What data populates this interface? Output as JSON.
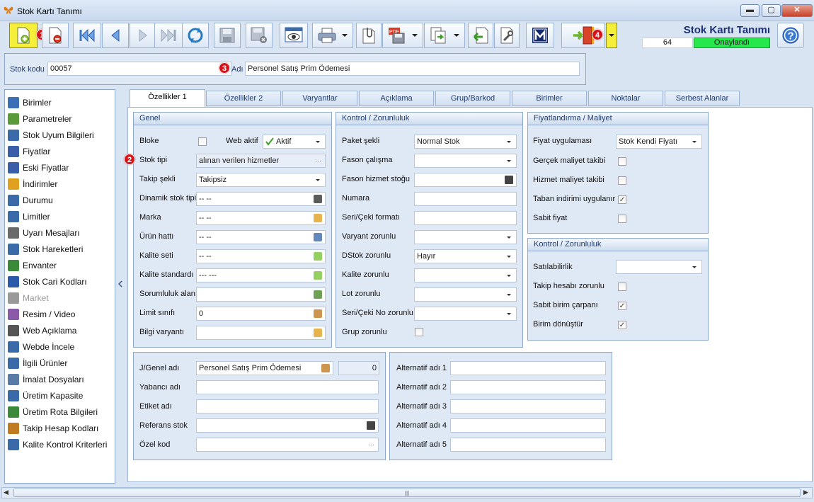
{
  "window": {
    "title": "Stok Kartı Tanımı",
    "controls": {
      "minimize": "▬",
      "maximize": "▢",
      "close": "✕"
    }
  },
  "toolbar": {
    "badges": [
      "1",
      "4"
    ],
    "header_title": "Stok Kartı Tanımı",
    "record_count": "64",
    "status": "Onaylandı",
    "status_color": "#26e84c",
    "icons": [
      "new-document-icon",
      "delete-document-icon",
      "first-record-icon",
      "previous-record-icon",
      "next-record-icon",
      "last-record-icon",
      "refresh-icon",
      "save-icon",
      "save-delete-icon",
      "preview-icon",
      "print-icon",
      "attachment-icon",
      "pdf-export-icon",
      "copy-export-icon",
      "import-icon",
      "tools-icon",
      "m-logo-icon",
      "exit-door-icon",
      "help-icon"
    ]
  },
  "stock": {
    "code_label": "Stok kodu",
    "code_value": "00057",
    "name_label": "Adı",
    "name_value": "Personel Satış Prim Ödemesi",
    "badge3": "3"
  },
  "nav": {
    "items": [
      {
        "label": "Birimler",
        "color": "#3b6fb6"
      },
      {
        "label": "Parametreler",
        "color": "#5a9a3a"
      },
      {
        "label": "Stok Uyum Bilgileri",
        "color": "#3a6aa8"
      },
      {
        "label": "Fiyatlar",
        "color": "#3a5ea8"
      },
      {
        "label": "Eski Fiyatlar",
        "color": "#3a5ea8"
      },
      {
        "label": "İndirimler",
        "color": "#e0a020"
      },
      {
        "label": "Durumu",
        "color": "#3a6aa8"
      },
      {
        "label": "Limitler",
        "color": "#3a6aa8"
      },
      {
        "label": "Uyarı Mesajları",
        "color": "#6a6a6a"
      },
      {
        "label": "Stok Hareketleri",
        "color": "#3a6aa8"
      },
      {
        "label": "Envanter",
        "color": "#3a8a3a"
      },
      {
        "label": "Stok Cari Kodları",
        "color": "#2a5aa8"
      },
      {
        "label": "Market",
        "color": "#999999"
      },
      {
        "label": "Resim / Video",
        "color": "#8a5aa8"
      },
      {
        "label": "Web Açıklama",
        "color": "#555555"
      },
      {
        "label": "Webde İncele",
        "color": "#3a6aa8"
      },
      {
        "label": "İlgili Ürünler",
        "color": "#3a6aa8"
      },
      {
        "label": "İmalat Dosyaları",
        "color": "#5a7aa8"
      },
      {
        "label": "Üretim Kapasite",
        "color": "#3a6aa8"
      },
      {
        "label": "Üretim Rota Bilgileri",
        "color": "#3a8a3a"
      },
      {
        "label": "Takip Hesap Kodları",
        "color": "#c07a20"
      },
      {
        "label": "Kalite Kontrol Kriterleri",
        "color": "#3a6aa8"
      }
    ]
  },
  "tabs": [
    "Özellikler 1",
    "Özellikler 2",
    "Varyantlar",
    "Açıklama",
    "Grup/Barkod",
    "Birimler",
    "Noktalar",
    "Serbest Alanlar"
  ],
  "genel": {
    "title": "Genel",
    "bloke": "Bloke",
    "web_aktif": "Web aktif",
    "web_aktif_value": "Aktif",
    "badge2": "2",
    "rows": [
      {
        "label": "Stok tipi",
        "value": "alınan verilen hizmetler"
      },
      {
        "label": "Takip şekli",
        "value": "Takipsiz"
      },
      {
        "label": "Dinamik stok tipi",
        "value": "-- --"
      },
      {
        "label": "Marka",
        "value": "-- --"
      },
      {
        "label": "Ürün hattı",
        "value": "-- --"
      },
      {
        "label": "Kalite seti",
        "value": "-- --"
      },
      {
        "label": "Kalite standardı",
        "value": "--- ---"
      },
      {
        "label": "Sorumluluk alanı",
        "value": ""
      },
      {
        "label": "Limit sınıfı",
        "value": "0"
      },
      {
        "label": "Bilgi varyantı",
        "value": ""
      }
    ]
  },
  "kontrol": {
    "title": "Kontrol / Zorunluluk",
    "rows": [
      {
        "label": "Paket şekli",
        "value": "Normal Stok"
      },
      {
        "label": "Fason çalışma",
        "value": ""
      },
      {
        "label": "Fason hizmet stoğu",
        "value": ""
      },
      {
        "label": "Numara",
        "value": ""
      },
      {
        "label": "Seri/Çeki formatı",
        "value": ""
      },
      {
        "label": "Varyant zorunlu",
        "value": ""
      },
      {
        "label": "DStok zorunlu",
        "value": "Hayır"
      },
      {
        "label": "Kalite zorunlu",
        "value": ""
      },
      {
        "label": "Lot zorunlu",
        "value": ""
      },
      {
        "label": "Seri/Çeki No zorunlu",
        "value": ""
      },
      {
        "label": "Grup zorunlu",
        "value": ""
      }
    ]
  },
  "fiyat": {
    "title": "Fiyatlandırma / Maliyet",
    "uygulama_label": "Fiyat uygulaması",
    "uygulama_value": "Stok Kendi Fiyatı",
    "checks": [
      {
        "label": "Gerçek maliyet takibi",
        "checked": false
      },
      {
        "label": "Hizmet maliyet takibi",
        "checked": false
      },
      {
        "label": "Taban indirimi uygulanır",
        "checked": true
      },
      {
        "label": "Sabit fiyat",
        "checked": false
      }
    ]
  },
  "kontrol2": {
    "title": "Kontrol / Zorunluluk",
    "satilabilirlik": "Satılabilirlik",
    "checks": [
      {
        "label": "Takip hesabı zorunlu",
        "checked": false
      },
      {
        "label": "Sabit birim çarpanı",
        "checked": true
      },
      {
        "label": "Birim dönüştür",
        "checked": true
      }
    ]
  },
  "names": {
    "rows": [
      {
        "label": "J/Genel adı",
        "value": "Personel Satış Prim Ödemesi",
        "extra": "0"
      },
      {
        "label": "Yabancı adı",
        "value": ""
      },
      {
        "label": "Etiket adı",
        "value": ""
      },
      {
        "label": "Referans stok",
        "value": ""
      },
      {
        "label": "Özel kod",
        "value": ""
      }
    ]
  },
  "alts": {
    "rows": [
      "Alternatif adı 1",
      "Alternatif adı 2",
      "Alternatif adı 3",
      "Alternatif adı 4",
      "Alternatif adı 5"
    ]
  },
  "scroll": {
    "grip": "|||"
  }
}
